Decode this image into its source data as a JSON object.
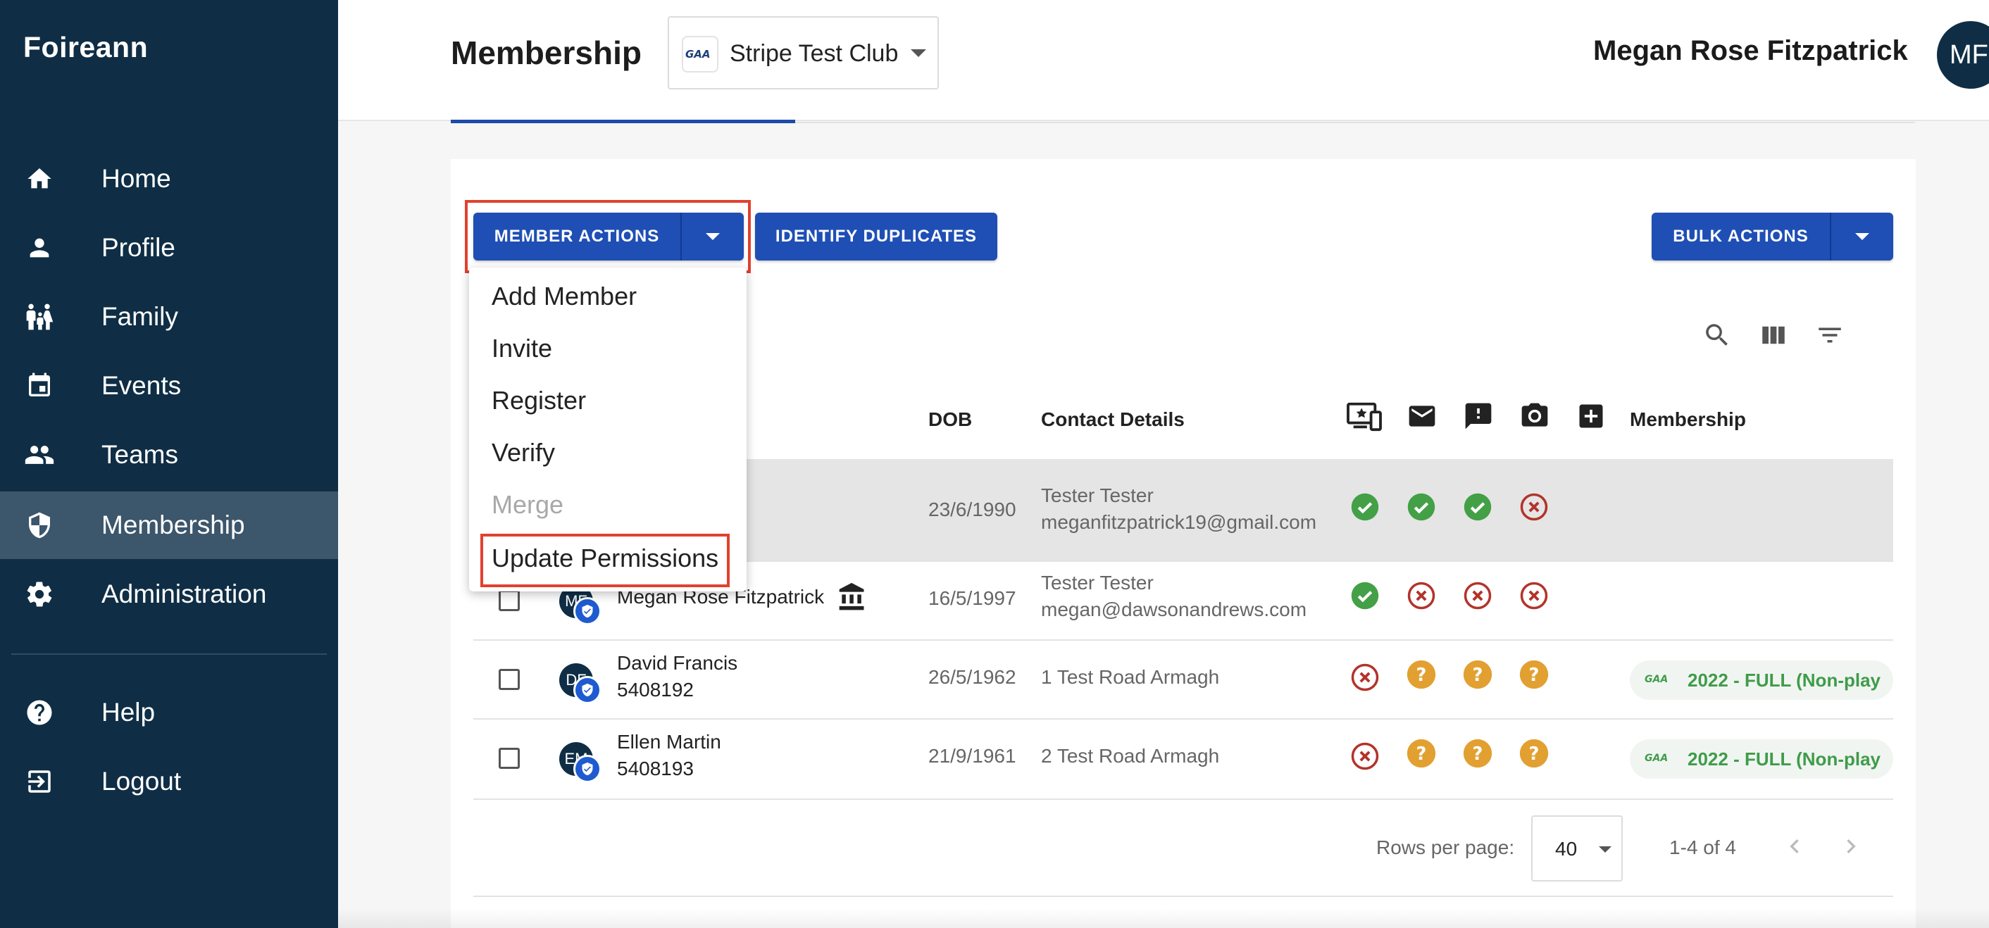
{
  "sidebar": {
    "brand": "Foireann",
    "items": [
      {
        "label": "Home",
        "icon": "home-icon"
      },
      {
        "label": "Profile",
        "icon": "person-icon"
      },
      {
        "label": "Family",
        "icon": "family-icon"
      },
      {
        "label": "Events",
        "icon": "calendar-icon"
      },
      {
        "label": "Teams",
        "icon": "group-icon"
      },
      {
        "label": "Membership",
        "icon": "shield-icon",
        "active": true
      },
      {
        "label": "Administration",
        "icon": "gear-icon"
      }
    ],
    "bottom_items": [
      {
        "label": "Help",
        "icon": "help-icon"
      },
      {
        "label": "Logout",
        "icon": "logout-icon"
      }
    ]
  },
  "header": {
    "title": "Membership",
    "club_select": {
      "value": "Stripe Test Club",
      "logo": "gaa-logo-icon"
    },
    "user_name": "Megan Rose Fitzpatrick",
    "user_initials": "MF"
  },
  "toolbar": {
    "member_actions_label": "MEMBER ACTIONS",
    "identify_duplicates_label": "IDENTIFY DUPLICATES",
    "bulk_actions_label": "BULK ACTIONS"
  },
  "member_actions_menu": {
    "items": [
      {
        "label": "Add Member",
        "enabled": true
      },
      {
        "label": "Invite",
        "enabled": true
      },
      {
        "label": "Register",
        "enabled": true
      },
      {
        "label": "Verify",
        "enabled": true
      },
      {
        "label": "Merge",
        "enabled": false
      },
      {
        "label": "Update Permissions",
        "enabled": true,
        "highlighted": true
      }
    ]
  },
  "table": {
    "columns": {
      "dob": "DOB",
      "contact": "Contact Details",
      "membership": "Membership",
      "status_icons": [
        "online-access-icon",
        "email-icon",
        "alert-icon",
        "camera-icon",
        "medical-icon"
      ]
    },
    "rows": [
      {
        "name": "",
        "number": "",
        "dob": "23/6/1990",
        "contact_name": "Tester Tester",
        "contact_detail": "meganfitzpatrick19@gmail.com",
        "statuses": [
          "ok",
          "ok",
          "ok",
          "no"
        ],
        "membership": "",
        "selected": true
      },
      {
        "name": "Megan Rose Fitzpatrick",
        "initials": "MF",
        "number": "",
        "dob": "16/5/1997",
        "contact_name": "Tester Tester",
        "contact_detail": "megan@dawsonandrews.com",
        "statuses": [
          "ok",
          "no",
          "no",
          "no"
        ],
        "membership": ""
      },
      {
        "name": "David Francis",
        "initials": "DF",
        "number": "5408192",
        "dob": "26/5/1962",
        "contact_detail": "1 Test Road Armagh",
        "statuses": [
          "no",
          "unknown",
          "unknown",
          "unknown"
        ],
        "membership": "2022 - FULL (Non-play"
      },
      {
        "name": "Ellen Martin",
        "initials": "EM",
        "number": "5408193",
        "dob": "21/9/1961",
        "contact_detail": "2 Test Road Armagh",
        "statuses": [
          "no",
          "unknown",
          "unknown",
          "unknown"
        ],
        "membership": "2022 - FULL (Non-play"
      }
    ]
  },
  "pagination": {
    "rows_per_page_label": "Rows per page:",
    "rows_per_page": "40",
    "range": "1-4 of 4"
  },
  "colors": {
    "sidebar_bg": "#0f2e45",
    "sidebar_active": "#3c566b",
    "primary": "#1f4fb5",
    "highlight_border": "#e1412e",
    "status_ok": "#43a047",
    "status_no": "#b3332a",
    "status_unknown": "#e2a031",
    "membership_chip_text": "#3f9c4a"
  }
}
